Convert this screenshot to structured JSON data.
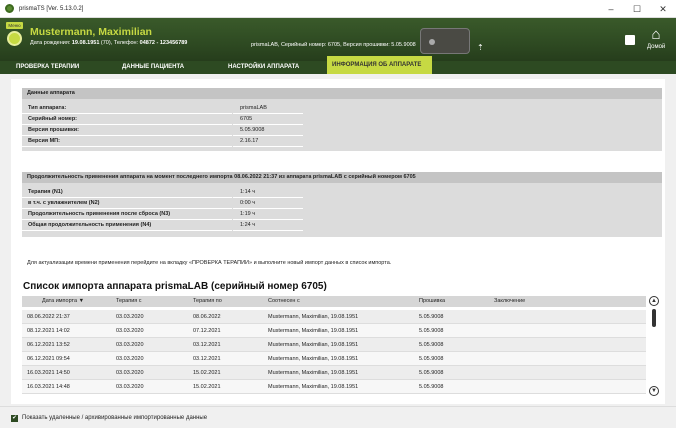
{
  "window": {
    "title": "prismaTS [Ver. 5.13.0.2]",
    "controls": [
      "–",
      "☐",
      "✕"
    ]
  },
  "header": {
    "menu_label": "Меню",
    "patient_name": "Mustermann, Maximilian",
    "dob_label": "Дата рождения:",
    "dob_value": "19.08.1951",
    "age": "(70),",
    "phone_label": "Телефон:",
    "phone_value": "04872 - 123456789",
    "device_info": "prismaLAB,  Серийный номер: 6705,  Версия прошивки: 5.05.9008",
    "home_label": "Домой",
    "colors": {
      "header_bg": "#2e4a22",
      "accent": "#c6d943"
    }
  },
  "tabs": [
    {
      "label": "ПРОВЕРКА ТЕРАПИИ",
      "active": false
    },
    {
      "label": "ДАННЫЕ ПАЦИЕНТА",
      "active": false
    },
    {
      "label": "НАСТРОЙКИ АППАРАТА",
      "active": false
    },
    {
      "label": "ИНФОРМАЦИЯ ОБ АППАРАТЕ",
      "active": true
    }
  ],
  "device_data": {
    "title": "Данные аппарата",
    "rows": [
      {
        "label": "Тип аппарата:",
        "value": "prismaLAB"
      },
      {
        "label": "Серийный номер:",
        "value": "6705"
      },
      {
        "label": "Версия прошивки:",
        "value": "5.05.9008"
      },
      {
        "label": "Версия МП:",
        "value": "2.16.17"
      }
    ]
  },
  "usage": {
    "title": "Продолжительность применения аппарата на момент последнего импорта 08.06.2022 21:37 из аппарата prismaLAB с серийный номером 6705",
    "rows": [
      {
        "label": "Терапия (N1)",
        "value": "1:14  ч"
      },
      {
        "label": "в т.ч. с увлажнителем (N2)",
        "value": "0:00  ч"
      },
      {
        "label": "Продолжительность применения после сброса (N3)",
        "value": "1:19  ч"
      },
      {
        "label": "Общая продолжительность применения (N4)",
        "value": "1:24  ч"
      }
    ]
  },
  "hint": "Для актуализации времени применения перейдите на вкладку «ПРОВЕРКА ТЕРАПИИ» и выполните новый импорт данных в список импорта.",
  "import_list": {
    "title": "Список импорта аппарата prismaLAB (серийный номер 6705)",
    "columns": [
      "Дата импорта ▼",
      "Терапия с",
      "Терапия по",
      "Соотнесен с",
      "Прошивка",
      "Заключение"
    ],
    "rows": [
      [
        "08.06.2022 21:37",
        "03.03.2020",
        "08.06.2022",
        "Mustermann, Maximilian, 19.08.1951",
        "5.05.9008",
        ""
      ],
      [
        "08.12.2021 14:02",
        "03.03.2020",
        "07.12.2021",
        "Mustermann, Maximilian, 19.08.1951",
        "5.05.9008",
        ""
      ],
      [
        "06.12.2021 13:52",
        "03.03.2020",
        "03.12.2021",
        "Mustermann, Maximilian, 19.08.1951",
        "5.05.9008",
        ""
      ],
      [
        "06.12.2021 09:54",
        "03.03.2020",
        "03.12.2021",
        "Mustermann, Maximilian, 19.08.1951",
        "5.05.9008",
        ""
      ],
      [
        "16.03.2021 14:50",
        "03.03.2020",
        "15.02.2021",
        "Mustermann, Maximilian, 19.08.1951",
        "5.05.9008",
        ""
      ],
      [
        "16.03.2021 14:48",
        "03.03.2020",
        "15.02.2021",
        "Mustermann, Maximilian, 19.08.1951",
        "5.05.9008",
        ""
      ]
    ]
  },
  "footer": {
    "checkbox_label": "Показать удаленные / архивированные импортированные данные",
    "checked": true
  }
}
